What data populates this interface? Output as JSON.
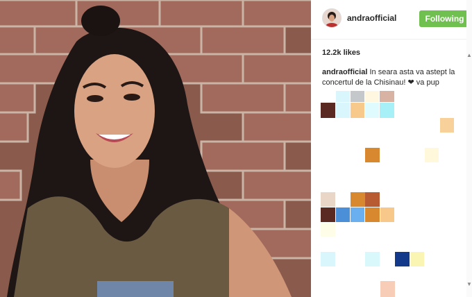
{
  "post": {
    "username": "andraofficial",
    "follow_label": "Following",
    "likes": "12.2k likes",
    "caption_user": "andraofficial",
    "caption_text": "In seara asta va astept la concertul de la Chisinau! ❤ va pup"
  },
  "colors": {
    "follow_green": "#70c050",
    "text": "#262626",
    "divider": "#efefef"
  },
  "icons": {
    "scroll_up": "▲",
    "scroll_down": "▼"
  }
}
